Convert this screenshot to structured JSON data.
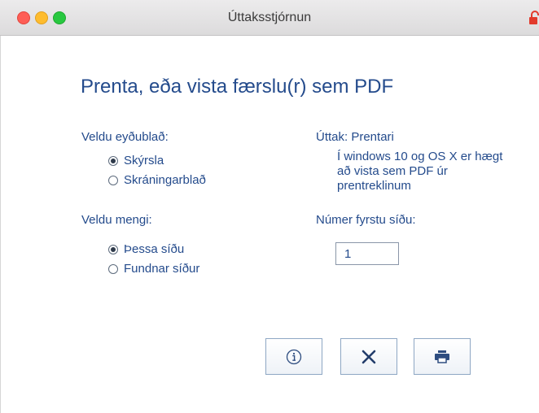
{
  "window": {
    "title": "Úttaksstjórnun"
  },
  "heading": "Prenta, eða vista færslu(r) sem PDF",
  "form_select": {
    "label": "Veldu eyðublað:",
    "options": [
      {
        "label": "Skýrsla",
        "selected": true
      },
      {
        "label": "Skráningarblað",
        "selected": false
      }
    ]
  },
  "range_select": {
    "label": "Veldu mengi:",
    "options": [
      {
        "label": "Þessa síðu",
        "selected": true
      },
      {
        "label": "Fundnar síður",
        "selected": false
      }
    ]
  },
  "output": {
    "label": "Úttak: Prentari",
    "info": "Í windows 10 og OS X er hægt að vista sem PDF úr prentreklinum"
  },
  "first_page": {
    "label": "Númer fyrstu síðu:",
    "value": "1"
  },
  "buttons": {
    "info_icon": "info-icon",
    "cancel_icon": "close-icon",
    "print_icon": "printer-icon"
  },
  "colors": {
    "text": "#244b8c",
    "button_border": "#8ea7c4"
  }
}
